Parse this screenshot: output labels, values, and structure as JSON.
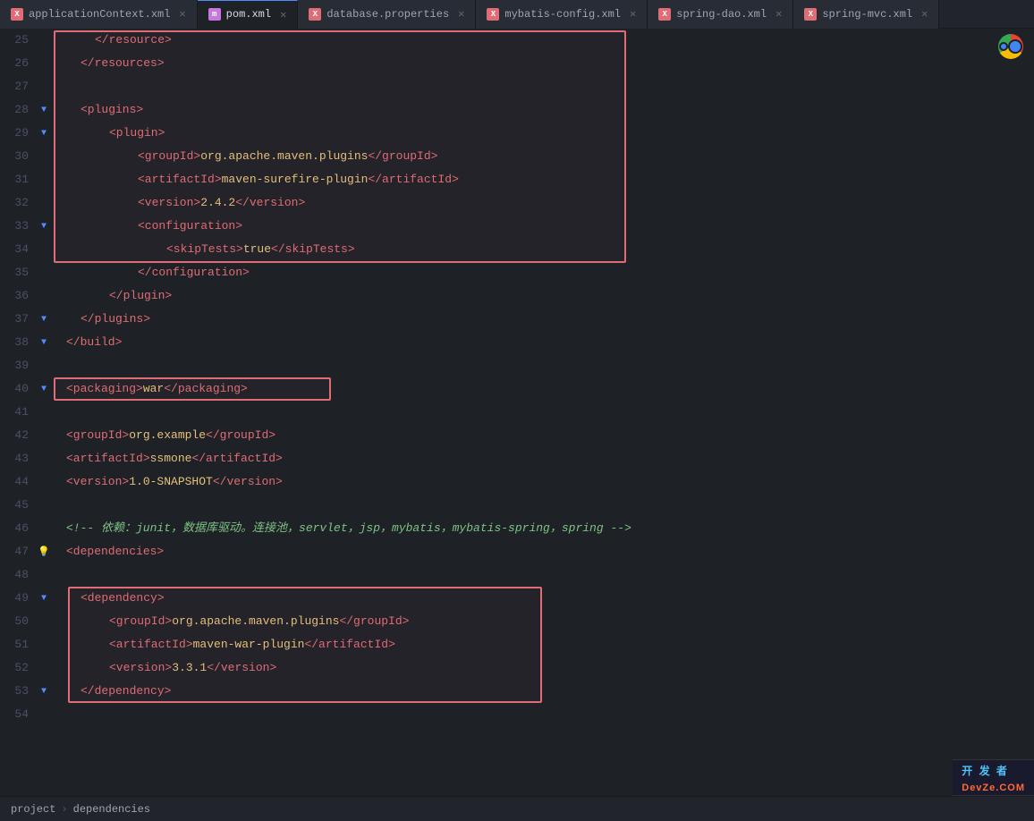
{
  "tabs": [
    {
      "id": "applicationContext",
      "label": "applicationContext.xml",
      "icon": "xml",
      "active": false
    },
    {
      "id": "pom",
      "label": "pom.xml",
      "icon": "m",
      "active": true
    },
    {
      "id": "database",
      "label": "database.properties",
      "icon": "xml",
      "active": false
    },
    {
      "id": "mybatis",
      "label": "mybatis-config.xml",
      "icon": "xml",
      "active": false
    },
    {
      "id": "springdao",
      "label": "spring-dao.xml",
      "icon": "xml",
      "active": false
    },
    {
      "id": "springmvc",
      "label": "spring-mvc.xml",
      "icon": "xml",
      "active": false
    }
  ],
  "lines": [
    {
      "num": 25,
      "indent": 2,
      "content": "</resource>",
      "type": "tag"
    },
    {
      "num": 26,
      "indent": 1,
      "content": "</resources>",
      "type": "tag"
    },
    {
      "num": 27,
      "indent": 0,
      "content": "",
      "type": "empty"
    },
    {
      "num": 28,
      "indent": 1,
      "content": "<plugins>",
      "type": "tag"
    },
    {
      "num": 29,
      "indent": 2,
      "content": "<plugin>",
      "type": "tag"
    },
    {
      "num": 30,
      "indent": 3,
      "content": "<groupId>org.apache.maven.plugins</groupId>",
      "type": "tag"
    },
    {
      "num": 31,
      "indent": 3,
      "content": "<artifactId>maven-surefire-plugin</artifactId>",
      "type": "tag"
    },
    {
      "num": 32,
      "indent": 3,
      "content": "<version>2.4.2</version>",
      "type": "tag"
    },
    {
      "num": 33,
      "indent": 3,
      "content": "<configuration>",
      "type": "tag"
    },
    {
      "num": 34,
      "indent": 4,
      "content": "<skipTests>true</skipTests>",
      "type": "tag"
    },
    {
      "num": 35,
      "indent": 3,
      "content": "</configuration>",
      "type": "tag"
    },
    {
      "num": 36,
      "indent": 2,
      "content": "</plugin>",
      "type": "tag"
    },
    {
      "num": 37,
      "indent": 1,
      "content": "</plugins>",
      "type": "tag"
    },
    {
      "num": 38,
      "indent": 0,
      "content": "</build>",
      "type": "tag"
    },
    {
      "num": 39,
      "indent": 0,
      "content": "",
      "type": "empty"
    },
    {
      "num": 40,
      "indent": 0,
      "content": "<packaging>war</packaging>",
      "type": "tag"
    },
    {
      "num": 41,
      "indent": 0,
      "content": "",
      "type": "empty"
    },
    {
      "num": 42,
      "indent": 0,
      "content": "<groupId>org.example</groupId>",
      "type": "tag"
    },
    {
      "num": 43,
      "indent": 0,
      "content": "<artifactId>ssmone</artifactId>",
      "type": "tag"
    },
    {
      "num": 44,
      "indent": 0,
      "content": "<version>1.0-SNAPSHOT</version>",
      "type": "tag"
    },
    {
      "num": 45,
      "indent": 0,
      "content": "",
      "type": "empty"
    },
    {
      "num": 46,
      "indent": 0,
      "content": "<!-- 依赖：junit，数据库驱动。连接池，servlet，jsp，mybatis，mybatis-spring，spring -->",
      "type": "comment"
    },
    {
      "num": 47,
      "indent": 0,
      "content": "<dependencies>",
      "type": "tag"
    },
    {
      "num": 48,
      "indent": 0,
      "content": "",
      "type": "empty"
    },
    {
      "num": 49,
      "indent": 1,
      "content": "<dependency>",
      "type": "tag"
    },
    {
      "num": 50,
      "indent": 2,
      "content": "<groupId>org.apache.maven.plugins</groupId>",
      "type": "tag"
    },
    {
      "num": 51,
      "indent": 2,
      "content": "<artifactId>maven-war-plugin</artifactId>",
      "type": "tag"
    },
    {
      "num": 52,
      "indent": 2,
      "content": "<version>3.3.1</version>",
      "type": "tag"
    },
    {
      "num": 53,
      "indent": 1,
      "content": "</dependency>",
      "type": "tag"
    },
    {
      "num": 54,
      "indent": 0,
      "content": "",
      "type": "empty"
    }
  ],
  "gutter_markers": {
    "28": "fold",
    "29": "fold",
    "33": "fold",
    "37": "fold",
    "38": "fold",
    "40": "fold",
    "47": "bulb",
    "49": "fold",
    "53": "fold"
  },
  "status_bar": {
    "breadcrumb1": "project",
    "breadcrumb2": "dependencies"
  },
  "watermark": {
    "text": "开 发 者",
    "subtext": "DevZe.COM"
  }
}
